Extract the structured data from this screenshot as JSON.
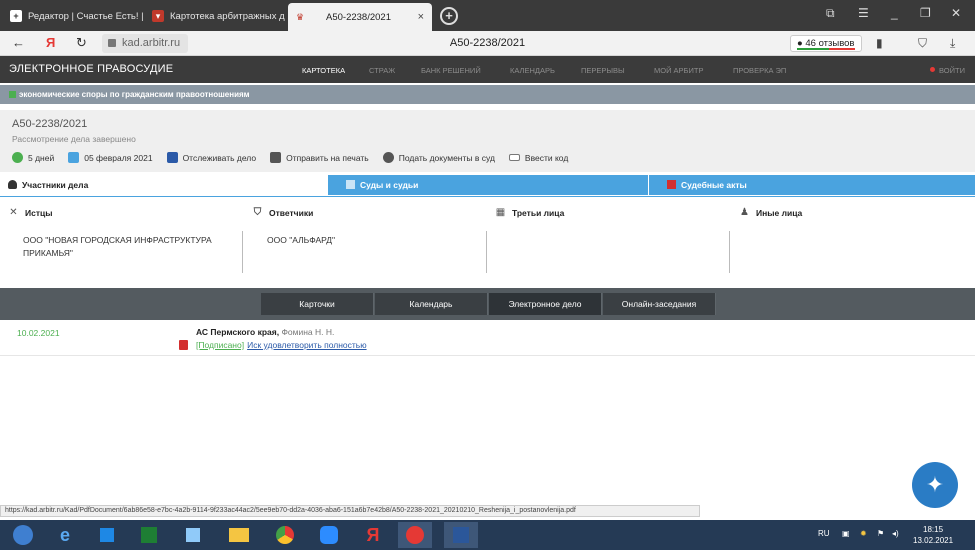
{
  "browser": {
    "tabs": [
      {
        "label": "Редактор | Счастье Есть! |",
        "icon": "editor-icon"
      },
      {
        "label": "Картотека арбитражных д",
        "icon": "arbitr-icon"
      },
      {
        "label": "А50-2238/2021",
        "icon": "emblem-icon",
        "close": "×"
      }
    ],
    "new_tab": "+",
    "back": "←",
    "yandex": "Я",
    "reload": "↻",
    "url": "kad.arbitr.ru",
    "page_title": "А50-2238/2021",
    "reviews": "46 отзывов"
  },
  "site": {
    "brand": "ЭЛЕКТРОННОЕ ПРАВОСУДИЕ",
    "menu": [
      "КАРТОТЕКА",
      "СТРАЖ",
      "БАНК РЕШЕНИЙ",
      "КАЛЕНДАРЬ",
      "ПЕРЕРЫВЫ",
      "МОЙ АРБИТР",
      "ПРОВЕРКА ЭП"
    ],
    "login": "ВОЙТИ",
    "category": "экономические споры по гражданским правоотношениям"
  },
  "case": {
    "number": "А50-2238/2021",
    "state": "Рассмотрение дела завершено",
    "tools": {
      "days": "5 дней",
      "date": "05 февраля 2021",
      "track": "Отслеживать дело",
      "print": "Отправить на печать",
      "submit": "Подать документы в суд",
      "code": "Ввести код"
    }
  },
  "participant_tabs": [
    "Участники дела",
    "Суды и судьи",
    "Судебные акты"
  ],
  "participants": {
    "plaintiffs": {
      "title": "Истцы",
      "value": "ООО \"НОВАЯ ГОРОДСКАЯ ИНФРАСТРУКТУРА ПРИКАМЬЯ\""
    },
    "defendants": {
      "title": "Ответчики",
      "value": "ООО \"АЛЬФАРД\""
    },
    "third": {
      "title": "Третьи лица",
      "value": ""
    },
    "others": {
      "title": "Иные лица",
      "value": ""
    }
  },
  "doc_tabs": [
    "Карточки",
    "Календарь",
    "Электронное дело",
    "Онлайн-заседания"
  ],
  "entry": {
    "date": "10.02.2021",
    "court": "АС Пермского края,",
    "judge": "Фомина Н. Н.",
    "signed": "[Подписано]",
    "document": "Иск удовлетворить полностью"
  },
  "status_url": "https://kad.arbitr.ru/Kad/PdfDocument/6ab86e58-e7bc-4a2b-9114-9f233ac44ac2/5ee9eb70-dd2a-4036-aba6-151a6b7e42b8/A50-2238-2021_20210210_Reshenija_i_postanovlenija.pdf",
  "tray": {
    "lang": "RU",
    "time": "18:15",
    "date": "13.02.2021"
  }
}
